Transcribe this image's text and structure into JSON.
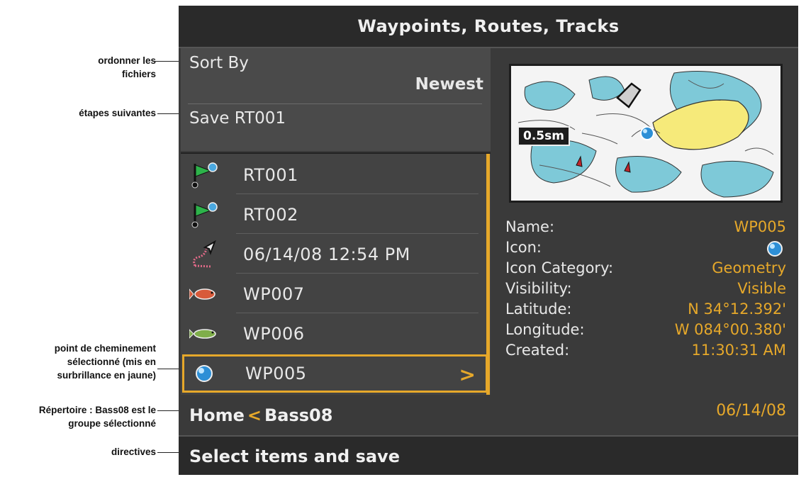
{
  "annotations": {
    "sort": "ordonner les fichiers",
    "next_steps": "étapes suivantes",
    "selected_waypoint": "point de cheminement sélectionné (mis en surbrillance en jaune)",
    "directory": "Répertoire : Bass08 est le groupe sélectionné",
    "instructions": "directives"
  },
  "window": {
    "title": "Waypoints, Routes, Tracks"
  },
  "menu": {
    "sort_label": "Sort By",
    "sort_value": "Newest",
    "save_label": "Save RT001"
  },
  "list": [
    {
      "label": "RT001",
      "icon": "route-flag-icon"
    },
    {
      "label": "RT002",
      "icon": "route-flag-icon"
    },
    {
      "label": "06/14/08 12:54 PM",
      "icon": "track-icon"
    },
    {
      "label": "WP007",
      "icon": "red-fish-icon"
    },
    {
      "label": "WP006",
      "icon": "bass-fish-icon"
    },
    {
      "label": "WP005",
      "icon": "blue-sphere-icon",
      "selected": true,
      "chevron": ">"
    }
  ],
  "breadcrumb": {
    "home": "Home",
    "separator": "<",
    "current": "Bass08"
  },
  "footer": {
    "instructions": "Select items and save"
  },
  "map": {
    "scale": "0.5sm"
  },
  "details": [
    {
      "key": "Name:",
      "value": "WP005"
    },
    {
      "key": "Icon:",
      "value": ""
    },
    {
      "key": "Icon Category:",
      "value": "Geometry"
    },
    {
      "key": "Visibility:",
      "value": "Visible"
    },
    {
      "key": "Latitude:",
      "value": "N 34°12.392'"
    },
    {
      "key": "Longitude:",
      "value": "W 084°00.380'"
    },
    {
      "key": "Created:",
      "value": "11:30:31 AM"
    },
    {
      "key": "",
      "value": "06/14/08"
    }
  ],
  "colors": {
    "accent": "#e6a82a",
    "panel": "#3a3a3a",
    "title_bar": "#2a2a2a"
  }
}
